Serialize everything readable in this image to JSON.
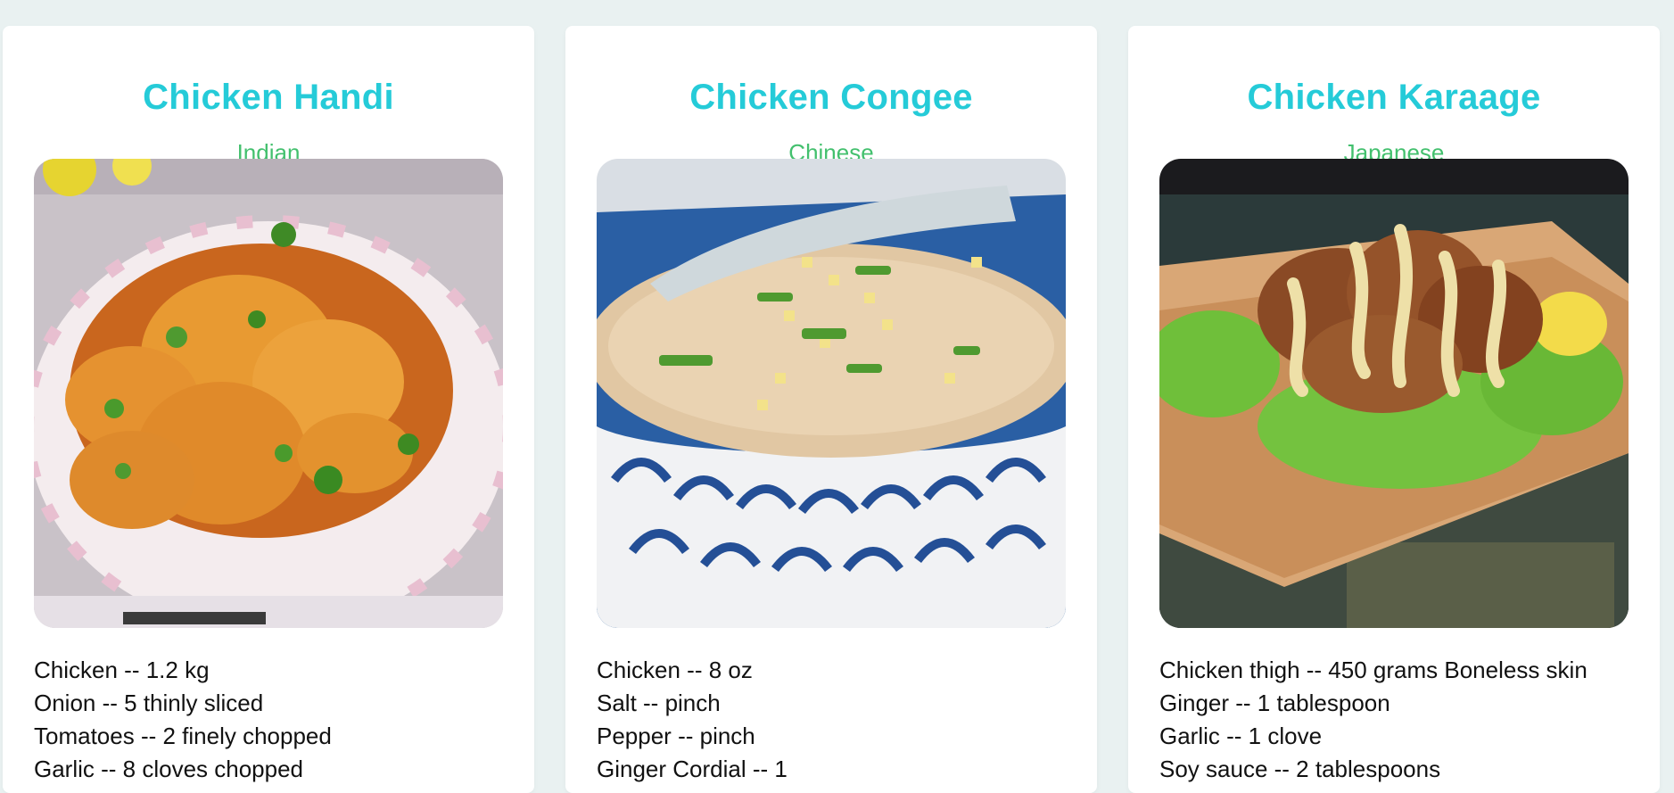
{
  "recipes": [
    {
      "title": "Chicken Handi",
      "cuisine": "Indian",
      "image": "chicken-handi-photo",
      "ingredients": [
        "Chicken -- 1.2 kg",
        "Onion -- 5 thinly sliced",
        "Tomatoes -- 2 finely chopped",
        "Garlic -- 8 cloves chopped"
      ]
    },
    {
      "title": "Chicken Congee",
      "cuisine": "Chinese",
      "image": "chicken-congee-photo",
      "ingredients": [
        "Chicken -- 8 oz",
        "Salt -- pinch",
        "Pepper -- pinch",
        "Ginger Cordial -- 1"
      ]
    },
    {
      "title": "Chicken Karaage",
      "cuisine": "Japanese",
      "image": "chicken-karaage-photo",
      "ingredients": [
        "Chicken thigh -- 450 grams Boneless skin",
        "Ginger -- 1 tablespoon",
        "Garlic -- 1 clove",
        "Soy sauce -- 2 tablespoons"
      ]
    }
  ],
  "colors": {
    "title": "#25cbd8",
    "cuisine": "#43c06e",
    "background": "#e9f1f1"
  }
}
